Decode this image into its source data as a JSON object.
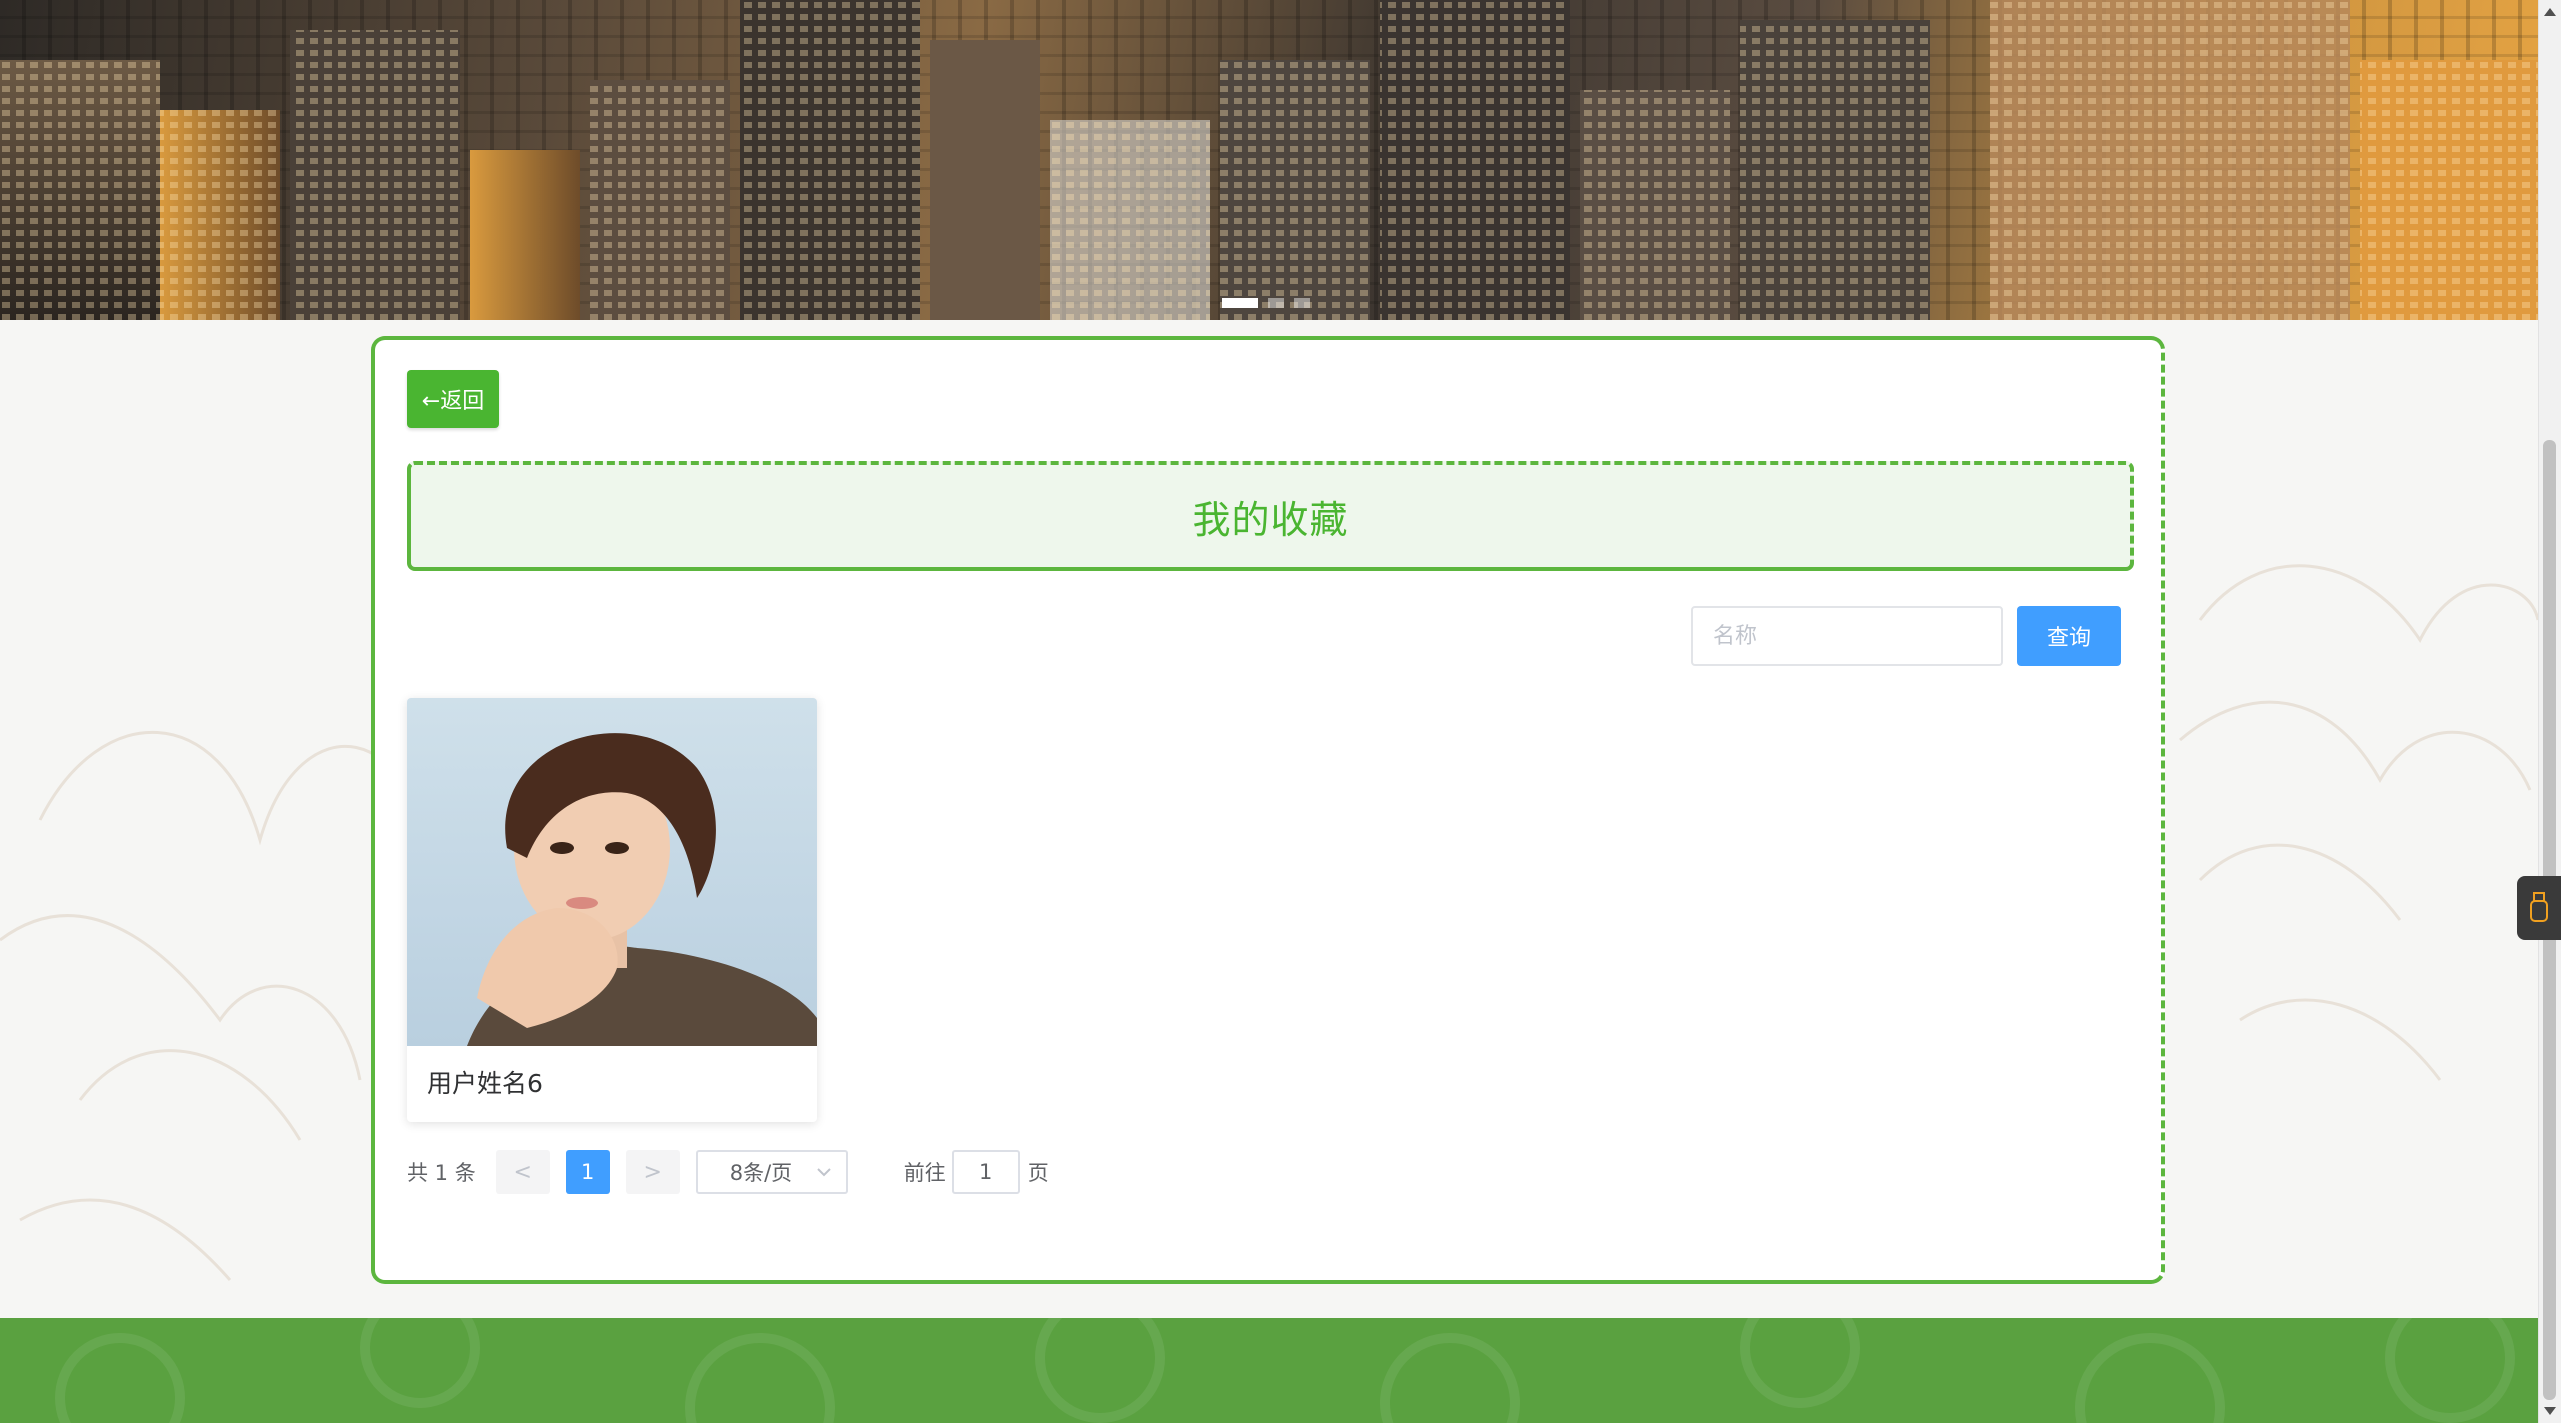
{
  "banner": {
    "slides_total": 3,
    "active_slide": 1
  },
  "toolbar": {
    "back_label": "←返回"
  },
  "page": {
    "title": "我的收藏"
  },
  "search": {
    "placeholder": "名称",
    "value": "",
    "button_label": "查询"
  },
  "items": [
    {
      "name": "用户姓名6",
      "image": "portrait-photo"
    }
  ],
  "pagination": {
    "total_text": "共 1 条",
    "prev_label": "<",
    "next_label": ">",
    "current_page": "1",
    "page_size_label": "8条/页",
    "jump_label": "前往",
    "jump_value": "1",
    "page_suffix": "页"
  },
  "colors": {
    "accent_green": "#5cb63e",
    "button_green": "#4ab531",
    "primary_blue": "#409eff",
    "footer_green": "#5aa140"
  },
  "icons": {
    "side_tab": "usb-icon",
    "page_size": "chevron-down-icon"
  }
}
